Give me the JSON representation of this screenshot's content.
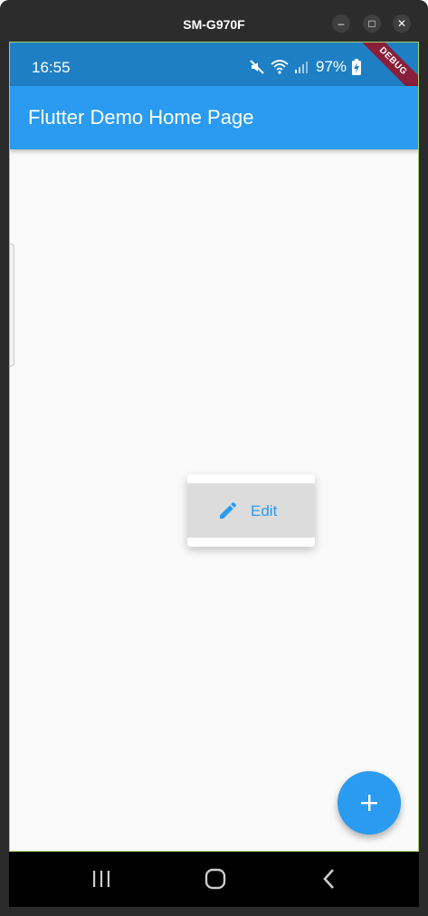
{
  "window": {
    "title": "SM-G970F",
    "controls": {
      "minimize": "–",
      "maximize": "□",
      "close": "✕"
    }
  },
  "statusbar": {
    "time": "16:55",
    "battery": "97%",
    "icons": [
      "mute-icon",
      "wifi-icon",
      "signal-icon",
      "battery-charging-icon"
    ]
  },
  "debug_banner": "DEBUG",
  "appbar": {
    "title": "Flutter Demo Home Page"
  },
  "popup_menu": {
    "items": [
      {
        "label": "Edit",
        "icon": "pencil-icon"
      }
    ]
  },
  "fab": {
    "icon": "plus-icon"
  },
  "navbar": {
    "buttons": [
      "recents-icon",
      "home-icon",
      "back-icon"
    ]
  },
  "colors": {
    "primary": "#2a9bf0",
    "statusbar": "#1e7fc5",
    "background": "#fafafa",
    "debug": "#8a1f3a"
  }
}
